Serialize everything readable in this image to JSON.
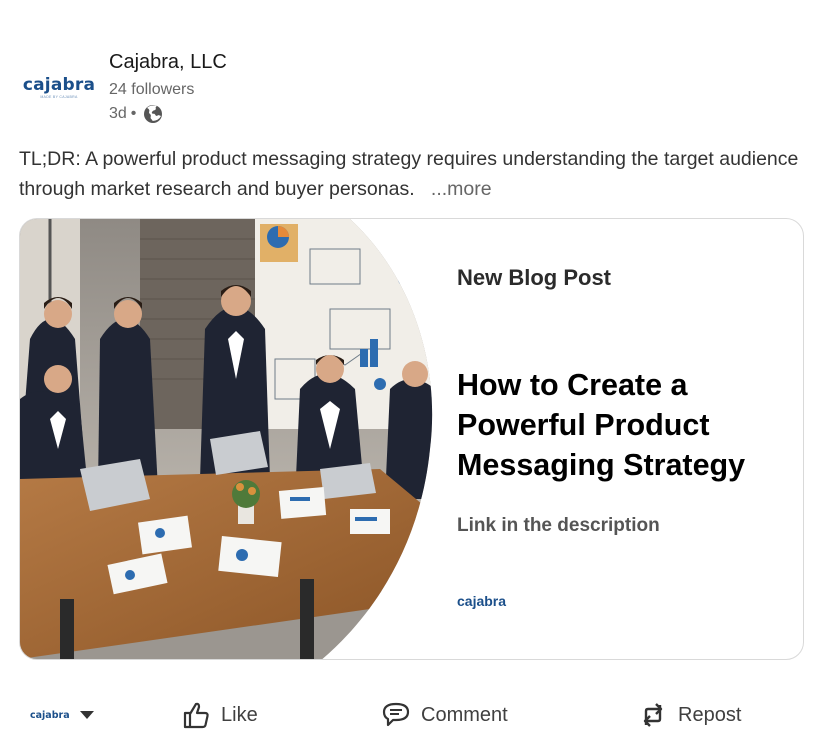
{
  "post": {
    "company_name": "Cajabra, LLC",
    "followers": "24 followers",
    "age": "3d",
    "separator": "•",
    "visibility_icon": "globe-icon",
    "text": "TL;DR: A powerful product messaging strategy requires understanding the target audience through market research and buyer personas.",
    "more_label": "...more"
  },
  "logo": {
    "word": "cajabra",
    "tagline": "MADE BY CAJABRA"
  },
  "card": {
    "eyebrow": "New Blog Post",
    "title": "How to Create a Powerful Product Messaging Strategy",
    "subtitle": "Link in the description",
    "brand": "cajabra"
  },
  "actions": {
    "actor_logo": "cajabra",
    "actor_dropdown_icon": "caret-down-icon",
    "like_label": "Like",
    "comment_label": "Comment",
    "repost_label": "Repost"
  },
  "colors": {
    "brand": "#1b4f8a",
    "text": "#191919",
    "muted": "#666666"
  }
}
